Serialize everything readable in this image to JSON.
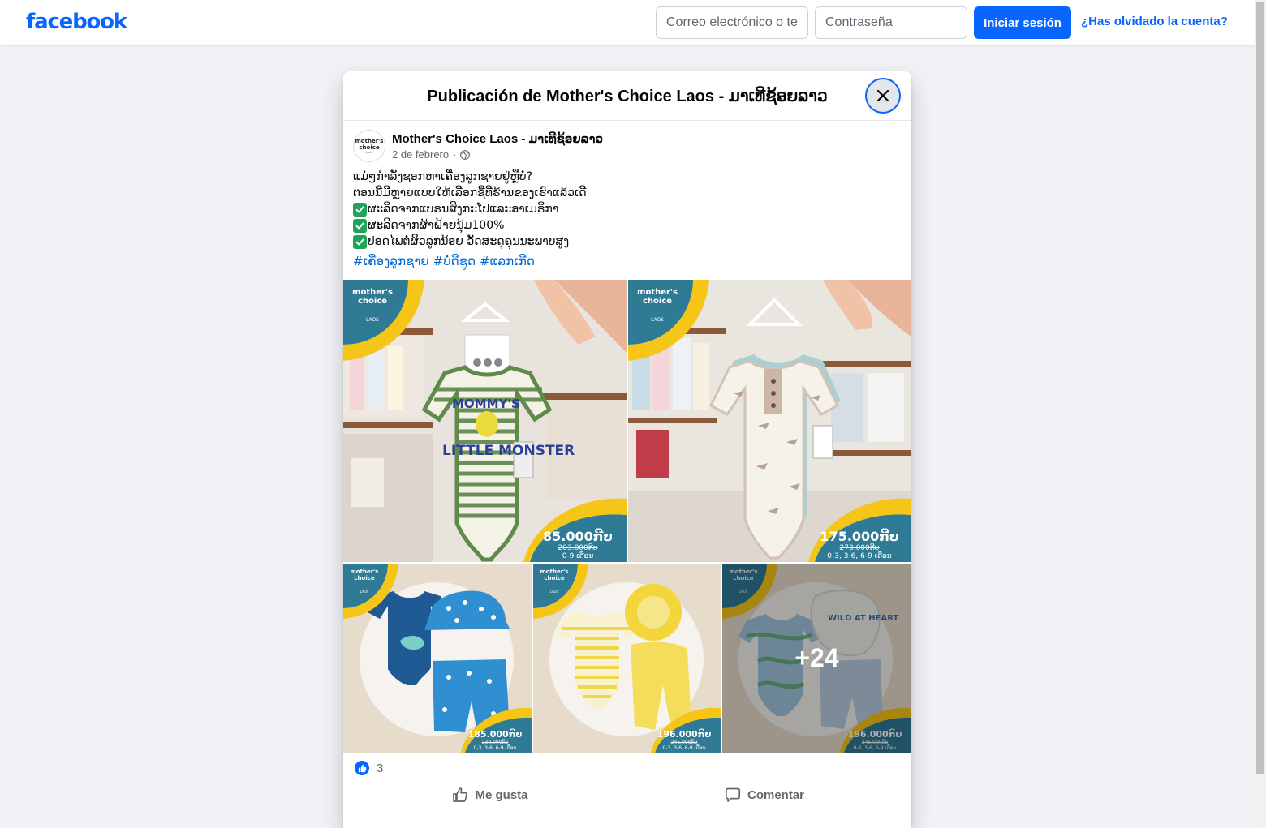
{
  "topbar": {
    "logo": "facebook",
    "email_placeholder": "Correo electrónico o teléfono",
    "password_placeholder": "Contraseña",
    "login_label": "Iniciar sesión",
    "forgot_label": "¿Has olvidado la cuenta?"
  },
  "modal": {
    "title": "Publicación de Mother's Choice Laos - ມາເທີຊ້ອຍລາວ",
    "close_icon": "close-icon"
  },
  "post": {
    "avatar_line1": "mother's",
    "avatar_line2": "choice",
    "avatar_line3": "LAOS",
    "author": "Mother's Choice Laos - ມາເທີຊ້ອຍລາວ",
    "date": "2 de febrero",
    "separator": "·",
    "privacy_icon": "globe-icon",
    "lines": [
      "ແມ່ໆກໍາລັງຊອກຫາເຄື່ອງລູກຊາຍຢູ່ຫຼືບໍ່?",
      "ຕອນນີ້ມີຫຼາຍແບບໃຫ້ເລືອກຊື້ທີ່ຮ້ານຂອງເຮົາແລ້ວເດີ"
    ],
    "checks": [
      "ຜະລິດຈາກແບຣນສິງກະໂປແລະອາເມຣິກາ",
      "ຜະລິດຈາກຜ້າຝ້າຍນຸ້ມ100%",
      "ປອດໄພຕໍ່ຜິວລູກນ້ອຍ ວັດສະດຸຄຸນນະພາບສູງ"
    ],
    "check_icon": "check-mark-icon",
    "hashtags": [
      "#ເຄື່ອງລູກຊາຍ",
      "#ບໍ່ດີຊູດ",
      "#ແລກເກີດ"
    ]
  },
  "photos": [
    {
      "brand": "mother's choice",
      "brand_sub": "LAOS",
      "price": "85.000ກີບ",
      "old_price": "203.000ກີບ",
      "sizes": "0-9 ເດືອນ",
      "shirt_text_1": "MOMMY'S",
      "shirt_text_2": "LITTLE MONSTER"
    },
    {
      "brand": "mother's choice",
      "brand_sub": "LAOS",
      "price": "175.000ກີບ",
      "old_price": "273.000ກີບ",
      "sizes": "0-3, 3-6, 6-9 ເດືອນ"
    },
    {
      "brand": "mother's choice",
      "brand_sub": "LAOS",
      "price": "185.000ກີບ",
      "old_price": "230.000ກີບ",
      "sizes": "0-3, 3-6, 6-9 ເດືອນ"
    },
    {
      "brand": "mother's choice",
      "brand_sub": "LAOS",
      "price": "196.000ກີບ",
      "old_price": "245.000ກີບ",
      "sizes": "0-3, 3-6, 6-9 ເດືອນ"
    },
    {
      "brand": "mother's choice",
      "brand_sub": "LAOS",
      "price": "196.000ກີບ",
      "old_price": "245.000ກີບ",
      "sizes": "0-3, 3-6, 6-9 ເດືອນ",
      "more_count": "+24",
      "bib_text": "WILD AT HEART"
    }
  ],
  "reactions": {
    "icon": "like-icon",
    "count": "3"
  },
  "actions": {
    "like_label": "Me gusta",
    "comment_label": "Comentar"
  },
  "colors": {
    "brand_blue": "#0866ff",
    "link_blue": "#0064d1",
    "badge_teal": "#2f7a94",
    "badge_yellow": "#f5c518"
  }
}
